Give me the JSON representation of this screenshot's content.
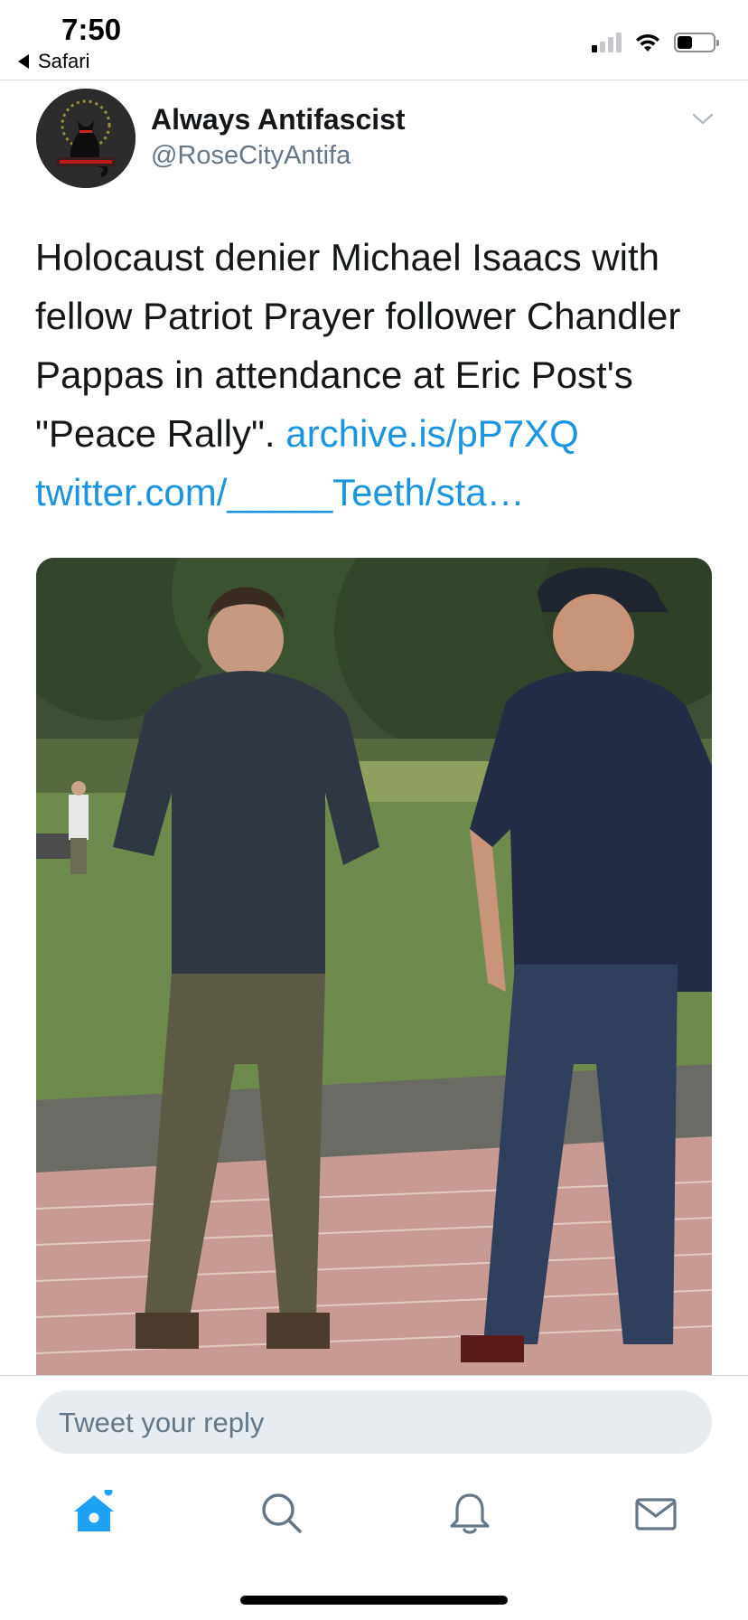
{
  "status_bar": {
    "time": "7:50",
    "back_app": "Safari",
    "icons": [
      "cellular-signal-icon",
      "wifi-icon",
      "battery-icon"
    ]
  },
  "tweet": {
    "author_name": "Always Antifascist",
    "author_handle": "@RoseCityAntifa",
    "text_plain": "Holocaust denier Michael Isaacs with fellow Patriot Prayer follower Chandler Pappas in attendance at Eric Post's \"Peace Rally\". ",
    "link_1": "archive.is/pP7XQ",
    "link_2": "twitter.com/_____Teeth/sta…",
    "menu_icon": "chevron-down-icon",
    "media_icon": "photo-two-men-in-park"
  },
  "reply": {
    "placeholder": "Tweet your reply"
  },
  "tab_bar": {
    "items": [
      "home-icon",
      "search-icon",
      "notifications-icon",
      "messages-icon"
    ],
    "active": "home-icon"
  },
  "colors": {
    "link": "#1b95e0",
    "text": "#14171a",
    "secondary": "#657786",
    "reply_bg": "#e6ecf0",
    "tab_active": "#1da1f2",
    "tab_inactive": "#657786"
  }
}
